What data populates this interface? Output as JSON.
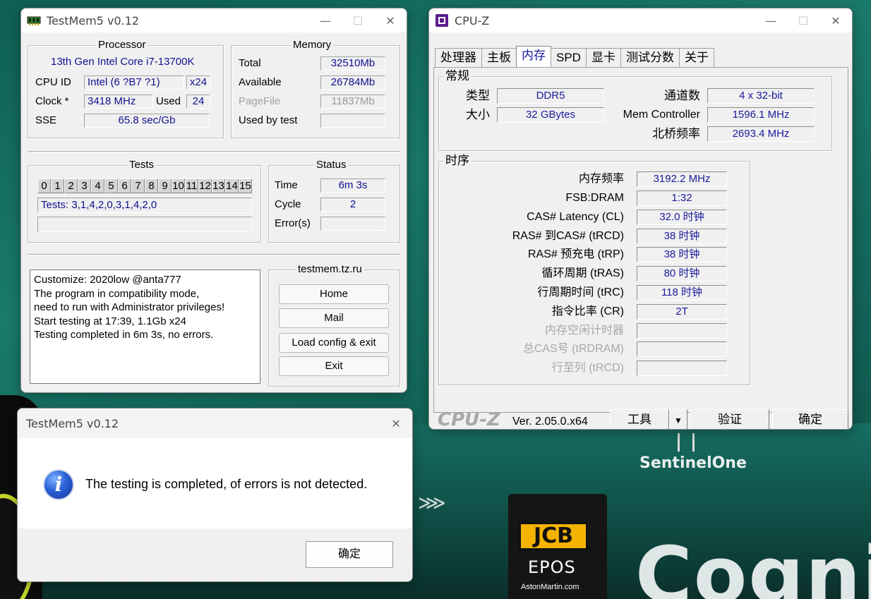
{
  "background": {
    "sentinel_text": "SentinelOne",
    "jcb_text": "JCB",
    "epos_text": "EPOS",
    "aston_text": "AstonMartin.com",
    "cogn_text": "Cogni"
  },
  "testmem_main": {
    "title": "TestMem5 v0.12",
    "processor": {
      "group_title": "Processor",
      "name": "13th Gen Intel Core i7-13700K",
      "cpu_id_label": "CPU ID",
      "cpu_id_value": "Intel (6 ?B7 ?1)",
      "threads": "x24",
      "clock_label": "Clock *",
      "clock_value": "3418 MHz",
      "used_label": "Used",
      "used_value": "24",
      "sse_label": "SSE",
      "sse_value": "65.8 sec/Gb"
    },
    "memory": {
      "group_title": "Memory",
      "total_label": "Total",
      "total_value": "32510Mb",
      "available_label": "Available",
      "available_value": "26784Mb",
      "pagefile_label": "PageFile",
      "pagefile_value": "11837Mb",
      "used_by_test_label": "Used by test",
      "used_by_test_value": ""
    },
    "tests": {
      "group_title": "Tests",
      "numbers": [
        "0",
        "1",
        "2",
        "3",
        "4",
        "5",
        "6",
        "7",
        "8",
        "9",
        "10",
        "11",
        "12",
        "13",
        "14",
        "15"
      ],
      "sequence": "Tests: 3,1,4,2,0,3,1,4,2,0",
      "extra": ""
    },
    "status": {
      "group_title": "Status",
      "time_label": "Time",
      "time_value": "6m 3s",
      "cycle_label": "Cycle",
      "cycle_value": "2",
      "errors_label": "Error(s)",
      "errors_value": ""
    },
    "log": "Customize: 2020low @anta777\nThe program in compatibility mode,\nneed to run with Administrator privileges!\nStart testing at 17:39, 1.1Gb x24\nTesting completed in 6m 3s, no errors.",
    "links": {
      "group_title": "testmem.tz.ru",
      "home": "Home",
      "mail": "Mail",
      "load_config": "Load config & exit",
      "exit": "Exit"
    }
  },
  "testmem_dialog": {
    "title": "TestMem5 v0.12",
    "message": "The testing is completed, of errors is not detected.",
    "ok_label": "确定",
    "icon": "info-icon"
  },
  "cpuz": {
    "title": "CPU-Z",
    "tabs": [
      "处理器",
      "主板",
      "内存",
      "SPD",
      "显卡",
      "测试分数",
      "关于"
    ],
    "active_tab": "内存",
    "general": {
      "group_title": "常规",
      "type_label": "类型",
      "type_value": "DDR5",
      "size_label": "大小",
      "size_value": "32 GBytes",
      "channels_label": "通道数",
      "channels_value": "4 x 32-bit",
      "mem_controller_label": "Mem Controller",
      "mem_controller_value": "1596.1 MHz",
      "nb_freq_label": "北桥频率",
      "nb_freq_value": "2693.4 MHz"
    },
    "timings": {
      "group_title": "时序",
      "rows": [
        {
          "label": "内存频率",
          "value": "3192.2 MHz",
          "enabled": true
        },
        {
          "label": "FSB:DRAM",
          "value": "1:32",
          "enabled": true
        },
        {
          "label": "CAS# Latency (CL)",
          "value": "32.0 时钟",
          "enabled": true
        },
        {
          "label": "RAS# 到CAS# (tRCD)",
          "value": "38 时钟",
          "enabled": true
        },
        {
          "label": "RAS# 预充电 (tRP)",
          "value": "38 时钟",
          "enabled": true
        },
        {
          "label": "循环周期 (tRAS)",
          "value": "80 时钟",
          "enabled": true
        },
        {
          "label": "行周期时间 (tRC)",
          "value": "118 时钟",
          "enabled": true
        },
        {
          "label": "指令比率 (CR)",
          "value": "2T",
          "enabled": true
        },
        {
          "label": "内存空闲计时器",
          "value": "",
          "enabled": false
        },
        {
          "label": "总CAS号 (tRDRAM)",
          "value": "",
          "enabled": false
        },
        {
          "label": "行至列 (tRCD)",
          "value": "",
          "enabled": false
        }
      ]
    },
    "footer": {
      "logo": "CPU-Z",
      "version": "Ver. 2.05.0.x64",
      "tools_label": "工具",
      "validate_label": "验证",
      "ok_label": "确定"
    }
  }
}
